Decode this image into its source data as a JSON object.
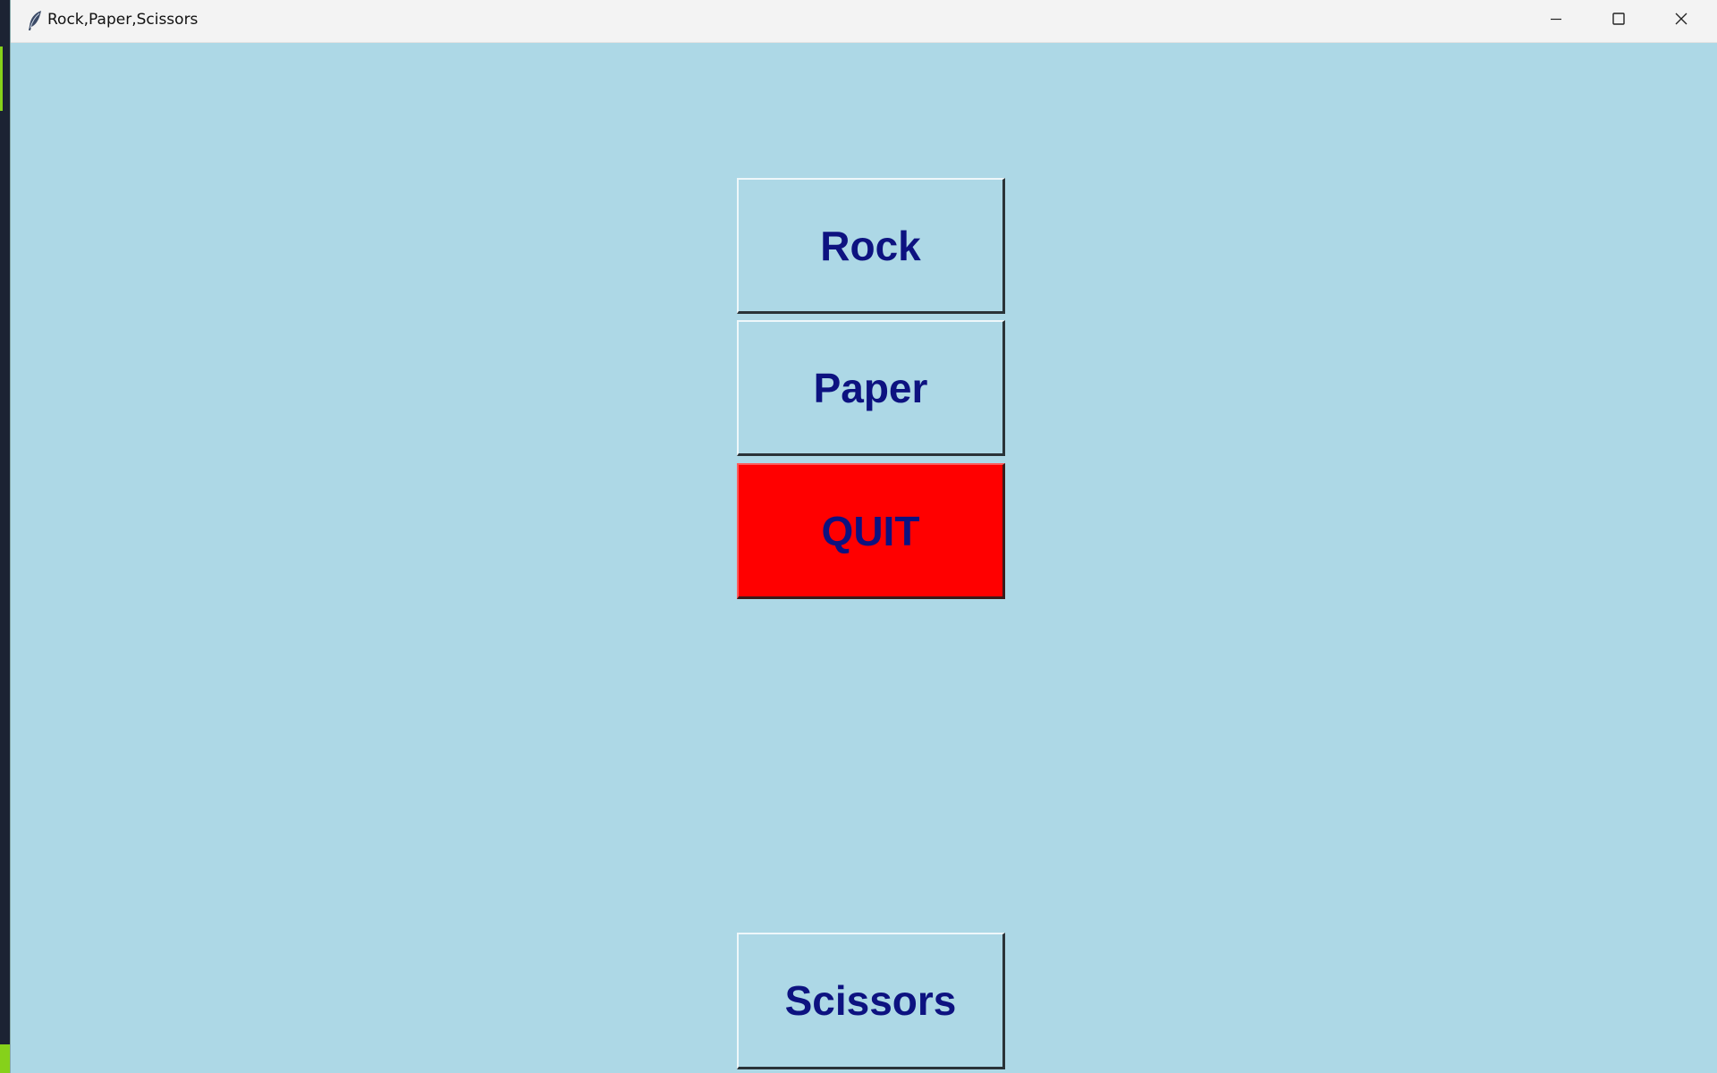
{
  "window": {
    "title": "Rock,Paper,Scissors",
    "app_icon": "feather-icon",
    "controls": {
      "minimize_icon": "minimize-icon",
      "maximize_icon": "maximize-icon",
      "close_icon": "close-icon"
    }
  },
  "buttons": {
    "rock": "Rock",
    "paper": "Paper",
    "quit": "QUIT",
    "scissors": "Scissors"
  },
  "colors": {
    "background": "#add8e6",
    "button_text": "#0d1280",
    "quit_background": "#ff0000"
  }
}
